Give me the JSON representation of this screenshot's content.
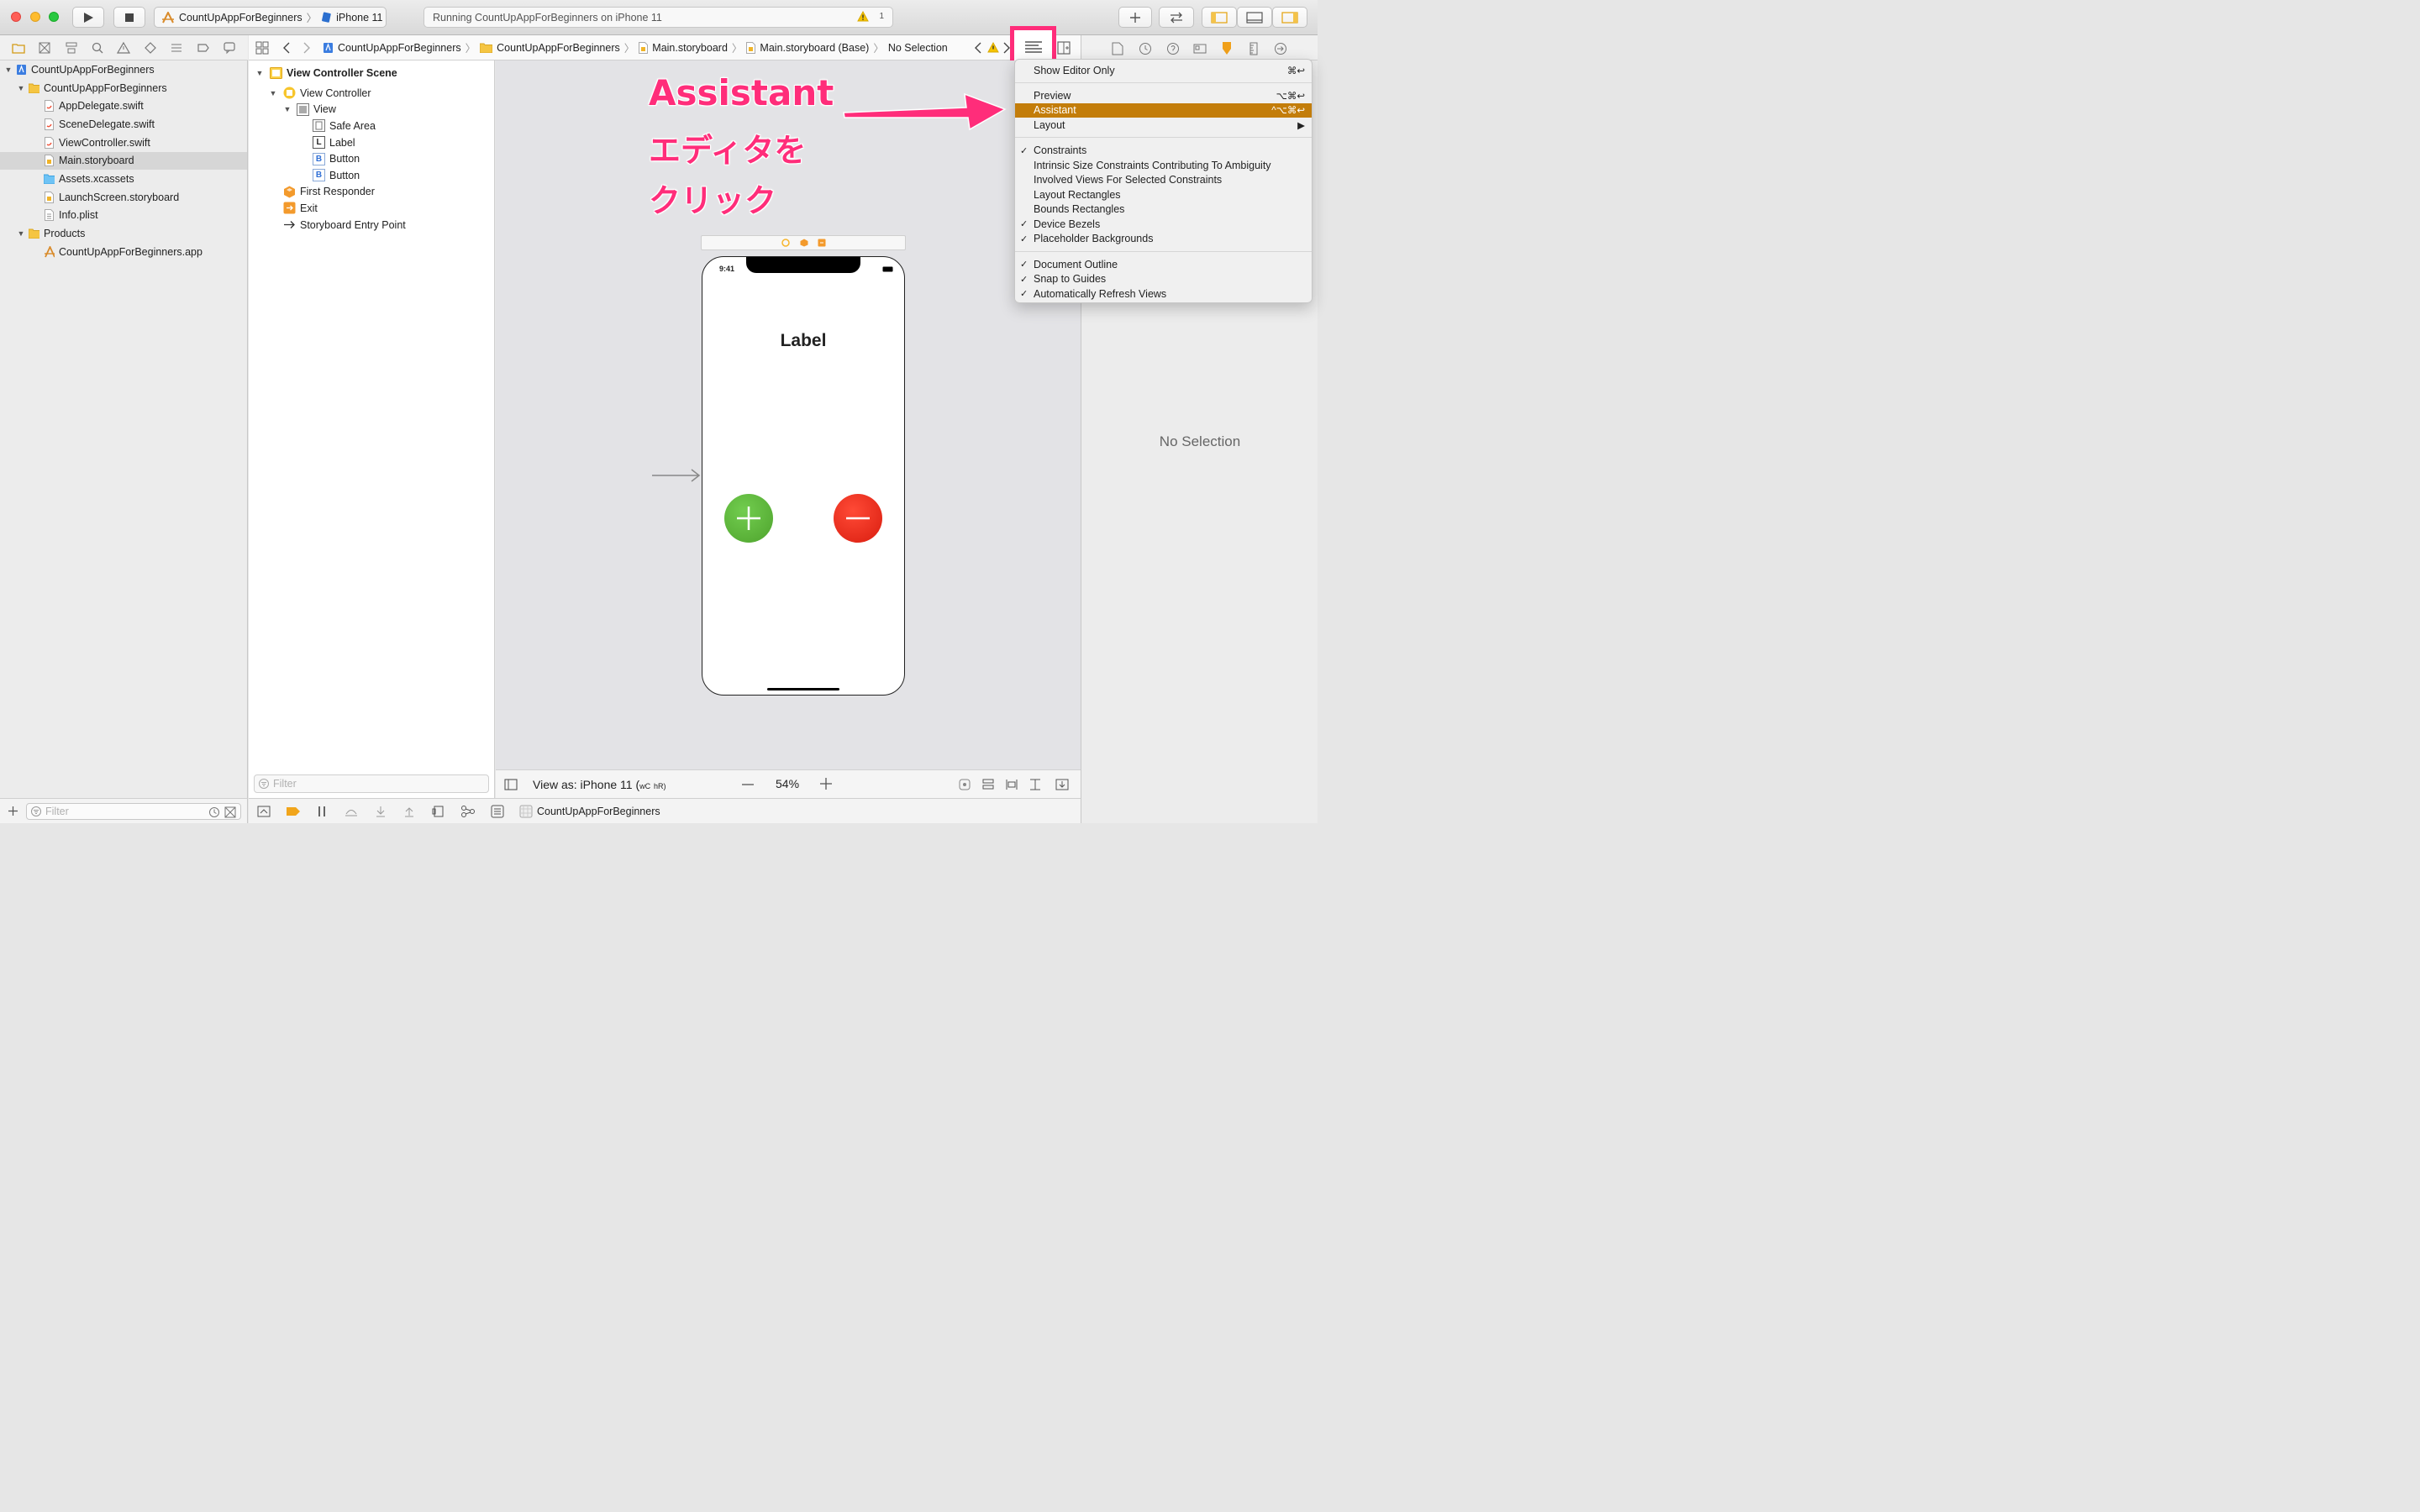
{
  "toolbar": {
    "scheme_project": "CountUpAppForBeginners",
    "scheme_device": "iPhone 11",
    "activity_text": "Running CountUpAppForBeginners on iPhone 11",
    "warning_count": "1"
  },
  "navigator": {
    "items": [
      {
        "label": "CountUpAppForBeginners",
        "icon": "project-icon"
      },
      {
        "label": "CountUpAppForBeginners",
        "icon": "folder-icon"
      },
      {
        "label": "AppDelegate.swift",
        "icon": "swift-file-icon"
      },
      {
        "label": "SceneDelegate.swift",
        "icon": "swift-file-icon"
      },
      {
        "label": "ViewController.swift",
        "icon": "swift-file-icon"
      },
      {
        "label": "Main.storyboard",
        "icon": "storyboard-file-icon"
      },
      {
        "label": "Assets.xcassets",
        "icon": "assets-folder-icon"
      },
      {
        "label": "LaunchScreen.storyboard",
        "icon": "storyboard-file-icon"
      },
      {
        "label": "Info.plist",
        "icon": "plist-file-icon"
      },
      {
        "label": "Products",
        "icon": "folder-icon"
      },
      {
        "label": "CountUpAppForBeginners.app",
        "icon": "app-icon"
      }
    ],
    "filter_placeholder": "Filter"
  },
  "jumpbar": {
    "crumbs": [
      "CountUpAppForBeginners",
      "CountUpAppForBeginners",
      "Main.storyboard",
      "Main.storyboard (Base)",
      "No Selection"
    ]
  },
  "outline": {
    "items": [
      {
        "label": "View Controller Scene"
      },
      {
        "label": "View Controller"
      },
      {
        "label": "View"
      },
      {
        "label": "Safe Area"
      },
      {
        "label": "Label",
        "glyph": "L"
      },
      {
        "label": "Button",
        "glyph": "B"
      },
      {
        "label": "Button",
        "glyph": "B"
      },
      {
        "label": "First Responder"
      },
      {
        "label": "Exit"
      },
      {
        "label": "Storyboard Entry Point"
      }
    ],
    "filter_placeholder": "Filter"
  },
  "canvas": {
    "status_time": "9:41",
    "label_text": "Label",
    "view_as_text": "View as: iPhone 11 (",
    "view_as_w": "wC",
    "view_as_h": "hR)",
    "zoom": "54%"
  },
  "debug": {
    "target_name": "CountUpAppForBeginners"
  },
  "inspector": {
    "empty_text": "No Selection"
  },
  "menu": {
    "items": [
      {
        "label": "Show Editor Only",
        "shortcut": "⌘↩",
        "checked": false
      },
      {
        "label": "Preview",
        "shortcut": "⌥⌘↩",
        "checked": false
      },
      {
        "label": "Assistant",
        "shortcut": "^⌥⌘↩",
        "checked": false,
        "highlighted": true
      },
      {
        "label": "Layout",
        "shortcut": "▶",
        "checked": false
      },
      {
        "label": "Constraints",
        "checked": true
      },
      {
        "label": "Intrinsic Size Constraints Contributing To Ambiguity",
        "checked": false
      },
      {
        "label": "Involved Views For Selected Constraints",
        "checked": false
      },
      {
        "label": "Layout Rectangles",
        "checked": false
      },
      {
        "label": "Bounds Rectangles",
        "checked": false
      },
      {
        "label": "Device Bezels",
        "checked": true
      },
      {
        "label": "Placeholder Backgrounds",
        "checked": true
      },
      {
        "label": "Document Outline",
        "checked": true
      },
      {
        "label": "Snap to Guides",
        "checked": true
      },
      {
        "label": "Automatically Refresh Views",
        "checked": true
      }
    ],
    "check_glyph": "✓"
  },
  "annotation": {
    "line1": "Assistant",
    "line2": "エディタを",
    "line3": "クリック",
    "color": "#ff2d7a"
  },
  "colors": {
    "menu_highlight": "#c37d0a",
    "plus_button": "#5cb83a",
    "minus_button": "#ee2a1c",
    "annotation": "#ff2d7a"
  }
}
